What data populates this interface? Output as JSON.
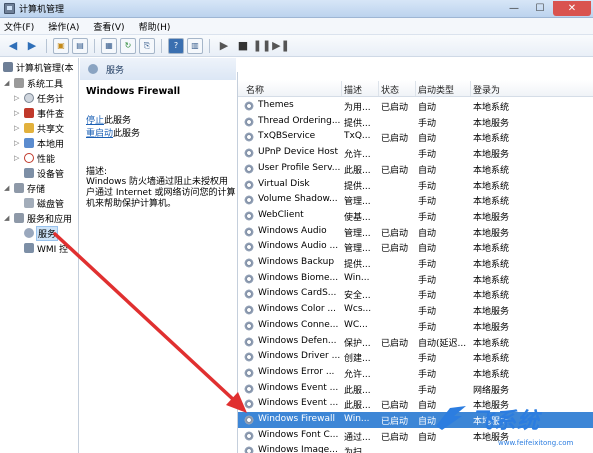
{
  "window": {
    "title": "计算机管理"
  },
  "menu": [
    "文件(F)",
    "操作(A)",
    "查看(V)",
    "帮助(H)"
  ],
  "tree": {
    "root": "计算机管理(本",
    "items": [
      {
        "label": "系统工具"
      },
      {
        "label": "任务计"
      },
      {
        "label": "事件查"
      },
      {
        "label": "共享文"
      },
      {
        "label": "本地用"
      },
      {
        "label": "性能"
      },
      {
        "label": "设备管"
      },
      {
        "label": "存储"
      },
      {
        "label": "磁盘管"
      },
      {
        "label": "服务和应用"
      },
      {
        "label": "服务"
      },
      {
        "label": "WMI 控"
      }
    ]
  },
  "middle": {
    "header": "服务",
    "service_name": "Windows Firewall",
    "stop_link": "停止",
    "stop_suffix": "此服务",
    "restart_link": "重启动",
    "restart_suffix": "此服务",
    "desc_label": "描述:",
    "desc_text": "Windows 防火墙通过阻止未授权用户通过 Internet 或网络访问您的计算机来帮助保护计算机。"
  },
  "list": {
    "columns": [
      "名称",
      "描述",
      "状态",
      "启动类型",
      "登录为"
    ],
    "rows": [
      {
        "name": "Themes",
        "desc": "为用...",
        "status": "已启动",
        "type": "自动",
        "logon": "本地系统"
      },
      {
        "name": "Thread Ordering...",
        "desc": "提供...",
        "status": "",
        "type": "手动",
        "logon": "本地服务"
      },
      {
        "name": "TxQBService",
        "desc": "TxQ...",
        "status": "已启动",
        "type": "自动",
        "logon": "本地系统"
      },
      {
        "name": "UPnP Device Host",
        "desc": "允许...",
        "status": "",
        "type": "手动",
        "logon": "本地服务"
      },
      {
        "name": "User Profile Serv...",
        "desc": "此服...",
        "status": "已启动",
        "type": "自动",
        "logon": "本地系统"
      },
      {
        "name": "Virtual Disk",
        "desc": "提供...",
        "status": "",
        "type": "手动",
        "logon": "本地系统"
      },
      {
        "name": "Volume Shadow...",
        "desc": "管理...",
        "status": "",
        "type": "手动",
        "logon": "本地系统"
      },
      {
        "name": "WebClient",
        "desc": "使基...",
        "status": "",
        "type": "手动",
        "logon": "本地服务"
      },
      {
        "name": "Windows Audio",
        "desc": "管理...",
        "status": "已启动",
        "type": "自动",
        "logon": "本地服务"
      },
      {
        "name": "Windows Audio ...",
        "desc": "管理...",
        "status": "已启动",
        "type": "自动",
        "logon": "本地系统"
      },
      {
        "name": "Windows Backup",
        "desc": "提供...",
        "status": "",
        "type": "手动",
        "logon": "本地系统"
      },
      {
        "name": "Windows Biome...",
        "desc": "Win...",
        "status": "",
        "type": "手动",
        "logon": "本地系统"
      },
      {
        "name": "Windows CardS...",
        "desc": "安全...",
        "status": "",
        "type": "手动",
        "logon": "本地系统"
      },
      {
        "name": "Windows Color ...",
        "desc": "Wcs...",
        "status": "",
        "type": "手动",
        "logon": "本地服务"
      },
      {
        "name": "Windows Conne...",
        "desc": "WC...",
        "status": "",
        "type": "手动",
        "logon": "本地服务"
      },
      {
        "name": "Windows Defen...",
        "desc": "保护...",
        "status": "已启动",
        "type": "自动(延迟...",
        "logon": "本地系统"
      },
      {
        "name": "Windows Driver ...",
        "desc": "创建...",
        "status": "",
        "type": "手动",
        "logon": "本地系统"
      },
      {
        "name": "Windows Error ...",
        "desc": "允许...",
        "status": "",
        "type": "手动",
        "logon": "本地系统"
      },
      {
        "name": "Windows Event ...",
        "desc": "此服...",
        "status": "",
        "type": "手动",
        "logon": "网络服务"
      },
      {
        "name": "Windows Event ...",
        "desc": "此服...",
        "status": "已启动",
        "type": "自动",
        "logon": "本地服务"
      },
      {
        "name": "Windows Firewall",
        "desc": "Win...",
        "status": "已启动",
        "type": "自动",
        "logon": "本地服务"
      },
      {
        "name": "Windows Font C...",
        "desc": "通过...",
        "status": "已启动",
        "type": "自动",
        "logon": "本地服务"
      },
      {
        "name": "Windows Image...",
        "desc": "为扫...",
        "status": "",
        "type": "",
        "logon": ""
      }
    ],
    "selected_index": 20
  },
  "watermark": {
    "main": "飞系统",
    "url": "www.feifeixitong.com",
    "color": "#2c7de0"
  },
  "colors": {
    "selection": "#3d86d6",
    "arrow": "#e03030",
    "link": "#1a5fb4"
  }
}
